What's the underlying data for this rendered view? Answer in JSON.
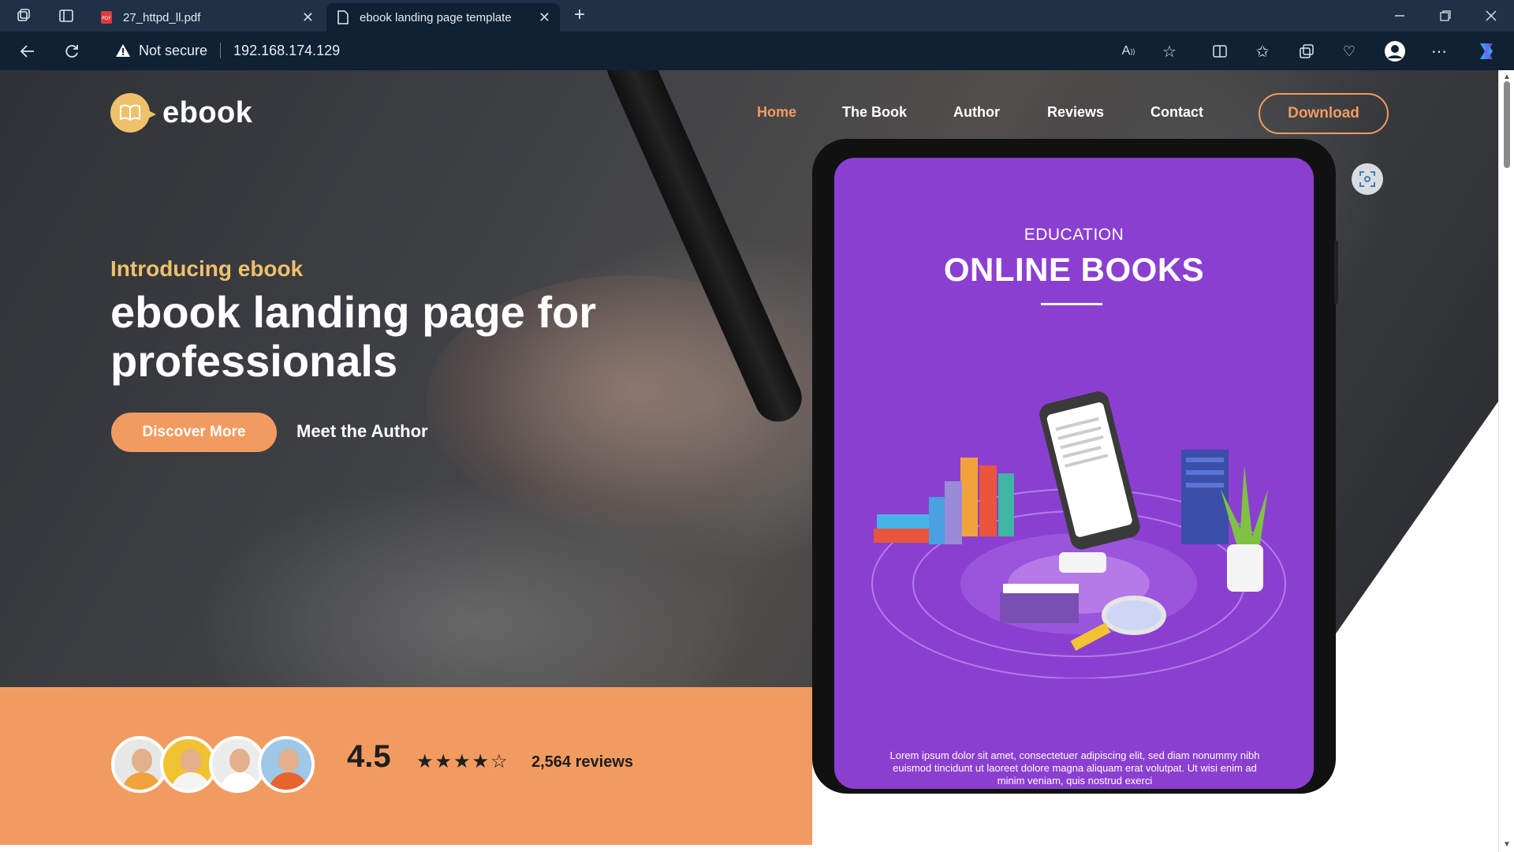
{
  "browser": {
    "tabs": [
      {
        "label": "27_httpd_ll.pdf",
        "active": false
      },
      {
        "label": "ebook landing page template",
        "active": true
      }
    ],
    "new_tab_symbol": "+",
    "security_label": "Not secure",
    "url": "192.168.174.129"
  },
  "header": {
    "logo_text": "ebook",
    "nav": [
      {
        "label": "Home",
        "active": true
      },
      {
        "label": "The Book",
        "active": false
      },
      {
        "label": "Author",
        "active": false
      },
      {
        "label": "Reviews",
        "active": false
      },
      {
        "label": "Contact",
        "active": false
      }
    ],
    "download_label": "Download"
  },
  "hero": {
    "kicker": "Introducing ebook",
    "headline": "ebook landing page for professionals",
    "primary_button": "Discover More",
    "secondary_button": "Meet the Author"
  },
  "reviews_strip": {
    "rating": "4.5",
    "stars": "★★★★☆",
    "stars_value": 4.5,
    "count_label": "2,564 reviews"
  },
  "tablet": {
    "kicker": "EDUCATION",
    "title": "ONLINE BOOKS",
    "lorem": "Lorem ipsum dolor sit amet, consectetuer adipiscing elit, sed diam nonummy nibh euismod tincidunt ut laoreet dolore magna aliquam erat volutpat. Ut wisi enim ad minim veniam, quis nostrud exerci"
  },
  "colors": {
    "accent_orange": "#f29b61",
    "accent_gold": "#efc16b",
    "tablet_screen": "#8b3fd1",
    "browser_bar": "#0f2133"
  }
}
